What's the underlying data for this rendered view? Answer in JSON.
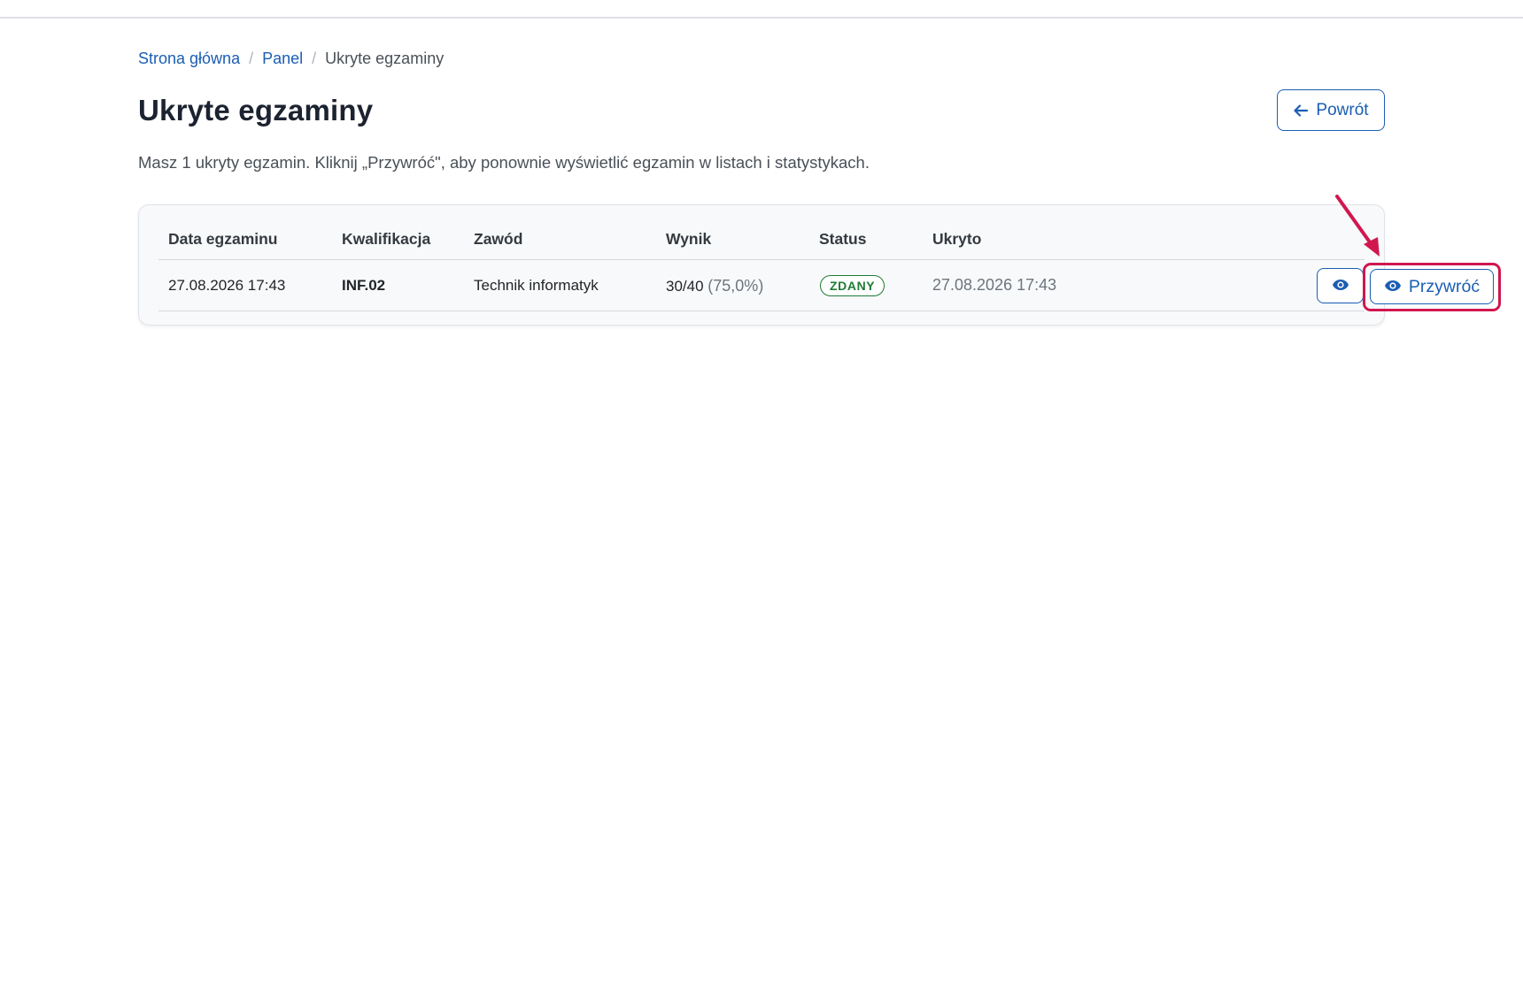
{
  "breadcrumb": {
    "home": "Strona główna",
    "panel": "Panel",
    "current": "Ukryte egzaminy",
    "separator": "/"
  },
  "page": {
    "title": "Ukryte egzaminy",
    "back_label": "Powrót",
    "lead": "Masz 1 ukryty egzamin. Kliknij „Przywróć\", aby ponownie wyświetlić egzamin w listach i statystykach."
  },
  "table": {
    "headers": [
      "Data egzaminu",
      "Kwalifikacja",
      "Zawód",
      "Wynik",
      "Status",
      "Ukryto"
    ],
    "rows": [
      {
        "date": "27.08.2026 17:43",
        "qualification": "INF.02",
        "profession": "Technik informatyk",
        "score": "30/40",
        "percent": "(75,0%)",
        "status": "ZDANY",
        "hidden_at": "27.08.2026 17:43",
        "restore_label": "Przywróć"
      }
    ]
  },
  "colors": {
    "primary": "#1a5eb3",
    "success": "#1e7b34",
    "annotation": "#d0174f"
  },
  "icons": {
    "back": "arrow-left-icon",
    "view": "eye-icon",
    "restore": "eye-icon"
  }
}
